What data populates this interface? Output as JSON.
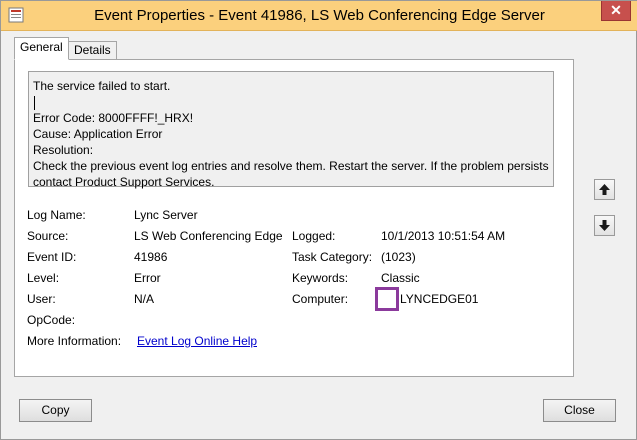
{
  "window": {
    "title": "Event Properties - Event 41986, LS Web Conferencing Edge Server",
    "close_label": "✕"
  },
  "tabs": [
    {
      "label": "General",
      "selected": true
    },
    {
      "label": "Details",
      "selected": false
    }
  ],
  "message": {
    "lines": [
      "The service failed to start.",
      "",
      "Error Code: 8000FFFF!_HRX!",
      "Cause: Application Error",
      "Resolution:",
      "Check the previous event log entries and resolve them. Restart the server. If the problem persists",
      "contact Product Support Services."
    ]
  },
  "fields": {
    "log_name": {
      "label": "Log Name:",
      "value": "Lync Server"
    },
    "source": {
      "label": "Source:",
      "value": "LS Web Conferencing Edge S"
    },
    "logged": {
      "label": "Logged:",
      "value": "10/1/2013 10:51:54 AM"
    },
    "event_id": {
      "label": "Event ID:",
      "value": "41986"
    },
    "task_category": {
      "label": "Task Category:",
      "value": "(1023)"
    },
    "level": {
      "label": "Level:",
      "value": "Error"
    },
    "keywords": {
      "label": "Keywords:",
      "value": "Classic"
    },
    "user": {
      "label": "User:",
      "value": "N/A"
    },
    "computer": {
      "label": "Computer:",
      "value": "LYNCEDGE01"
    },
    "opcode": {
      "label": "OpCode:",
      "value": ""
    },
    "more_info": {
      "label": "More Information:",
      "link_text": "Event Log Online Help"
    }
  },
  "nav": {
    "up_icon": "arrow-up-icon",
    "down_icon": "arrow-down-icon"
  },
  "buttons": {
    "copy": "Copy",
    "close": "Close"
  },
  "colors": {
    "titlebar": "#fbd07d",
    "close": "#c7504d",
    "highlight_box": "#8b3a9c",
    "link": "#0000cc"
  }
}
